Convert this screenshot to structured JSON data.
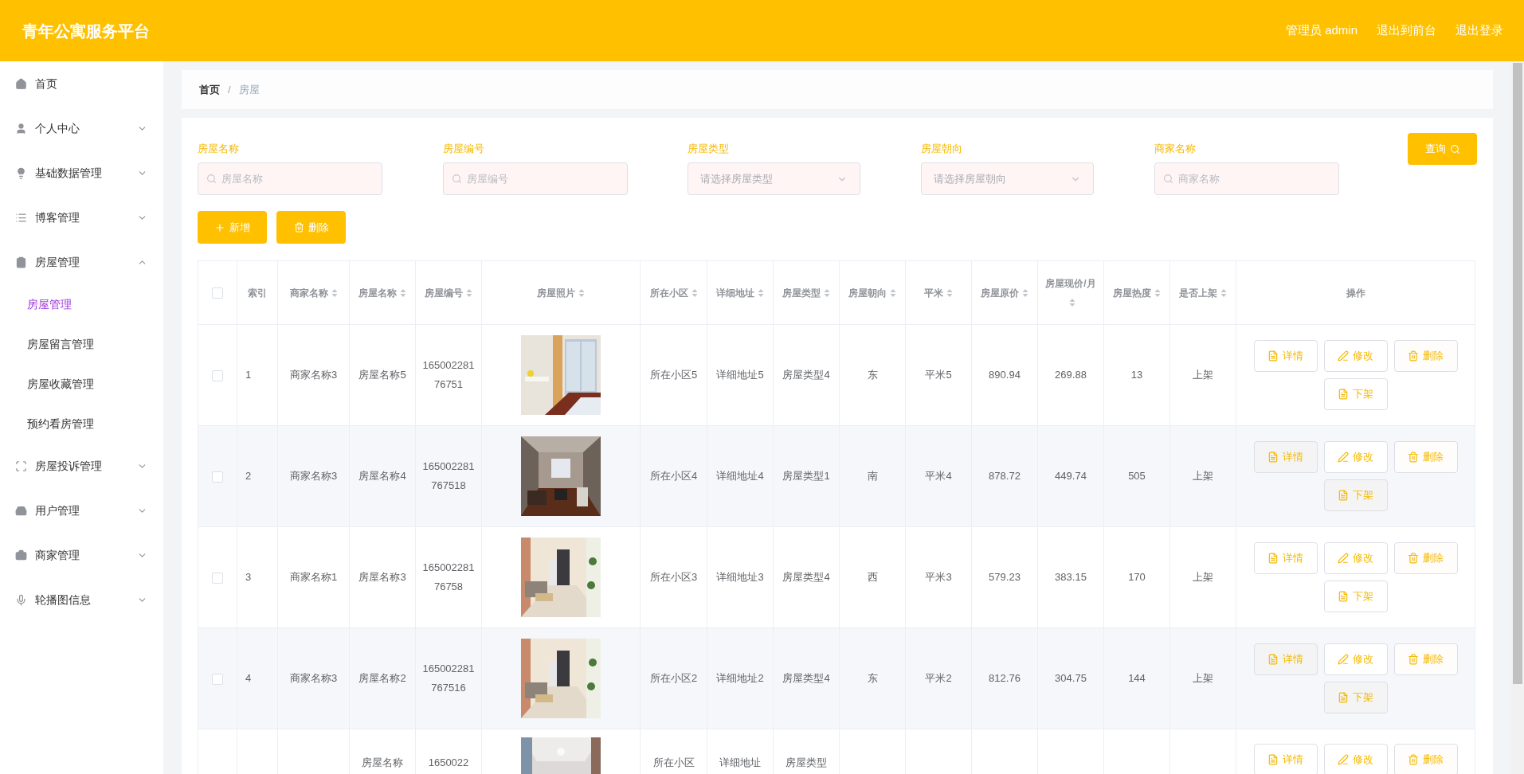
{
  "header": {
    "title": "青年公寓服务平台",
    "links": [
      "管理员 admin",
      "退出到前台",
      "退出登录"
    ]
  },
  "sidebar": {
    "items": [
      {
        "label": "首页",
        "selected": false
      },
      {
        "label": "个人中心",
        "selected": false,
        "expanded": false
      },
      {
        "label": "基础数据管理",
        "selected": false,
        "expanded": false
      },
      {
        "label": "博客管理",
        "selected": false,
        "expanded": false
      },
      {
        "label": "房屋管理",
        "selected": false,
        "expanded": true,
        "children": [
          {
            "label": "房屋管理",
            "selected": true
          },
          {
            "label": "房屋留言管理",
            "selected": false
          },
          {
            "label": "房屋收藏管理",
            "selected": false
          },
          {
            "label": "预约看房管理",
            "selected": false
          }
        ]
      },
      {
        "label": "房屋投诉管理",
        "selected": false,
        "expanded": false
      },
      {
        "label": "用户管理",
        "selected": false,
        "expanded": false
      },
      {
        "label": "商家管理",
        "selected": false,
        "expanded": false
      },
      {
        "label": "轮播图信息",
        "selected": false,
        "expanded": false
      }
    ]
  },
  "breadcrumb": [
    "首页",
    "/",
    "房屋"
  ],
  "filters": [
    {
      "kind": "input",
      "label": "房屋名称",
      "placeholder": "房屋名称"
    },
    {
      "kind": "input",
      "label": "房屋编号",
      "placeholder": "房屋编号"
    },
    {
      "kind": "select",
      "label": "房屋类型",
      "placeholder": "请选择房屋类型"
    },
    {
      "kind": "select",
      "label": "房屋朝向",
      "placeholder": "请选择房屋朝向"
    },
    {
      "kind": "input",
      "label": "商家名称",
      "placeholder": "商家名称"
    }
  ],
  "search_button": "查询",
  "actions": [
    {
      "kind": "add",
      "label": "新增"
    },
    {
      "kind": "delete",
      "label": "删除"
    }
  ],
  "table": {
    "header_checked": false,
    "columns": [
      {
        "label": "索引",
        "sortable": false
      },
      {
        "label": "商家名称",
        "sortable": true
      },
      {
        "label": "房屋名称",
        "sortable": true
      },
      {
        "label": "房屋编号",
        "sortable": true
      },
      {
        "label": "房屋照片",
        "sortable": true
      },
      {
        "label": "所在小区",
        "sortable": true
      },
      {
        "label": "详细地址",
        "sortable": true
      },
      {
        "label": "房屋类型",
        "sortable": true
      },
      {
        "label": "房屋朝向",
        "sortable": true
      },
      {
        "label": "平米",
        "sortable": true
      },
      {
        "label": "房屋原价",
        "sortable": true
      },
      {
        "label": "房屋现价/月",
        "sortable": true
      },
      {
        "label": "房屋热度",
        "sortable": true
      },
      {
        "label": "是否上架",
        "sortable": true
      },
      {
        "label": "操作",
        "sortable": false
      }
    ],
    "rows": [
      {
        "checked": false,
        "cells": [
          "1",
          "商家名称3",
          "房屋名称5",
          "16500228176751",
          null,
          "所在小区5",
          "详细地址5",
          "房屋类型4",
          "东",
          "平米5",
          "890.94",
          "269.88",
          "13",
          "上架"
        ],
        "buttons": [
          {
            "kind": "detail",
            "label": "详情"
          },
          {
            "kind": "edit",
            "label": "修改"
          },
          {
            "kind": "delete",
            "label": "删除"
          },
          {
            "kind": "detail",
            "label": "下架"
          }
        ]
      },
      {
        "checked": false,
        "cells": [
          "2",
          "商家名称3",
          "房屋名称4",
          "165002281767518",
          null,
          "所在小区4",
          "详细地址4",
          "房屋类型1",
          "南",
          "平米4",
          "878.72",
          "449.74",
          "505",
          "上架"
        ],
        "buttons": [
          {
            "kind": "detail",
            "label": "详情"
          },
          {
            "kind": "edit",
            "label": "修改"
          },
          {
            "kind": "delete",
            "label": "删除"
          },
          {
            "kind": "detail",
            "label": "下架"
          }
        ]
      },
      {
        "checked": false,
        "cells": [
          "3",
          "商家名称1",
          "房屋名称3",
          "16500228176758",
          null,
          "所在小区3",
          "详细地址3",
          "房屋类型4",
          "西",
          "平米3",
          "579.23",
          "383.15",
          "170",
          "上架"
        ],
        "buttons": [
          {
            "kind": "detail",
            "label": "详情"
          },
          {
            "kind": "edit",
            "label": "修改"
          },
          {
            "kind": "delete",
            "label": "删除"
          },
          {
            "kind": "detail",
            "label": "下架"
          }
        ]
      },
      {
        "checked": false,
        "cells": [
          "4",
          "商家名称3",
          "房屋名称2",
          "165002281767516",
          null,
          "所在小区2",
          "详细地址2",
          "房屋类型4",
          "东",
          "平米2",
          "812.76",
          "304.75",
          "144",
          "上架"
        ],
        "buttons": [
          {
            "kind": "detail",
            "label": "详情"
          },
          {
            "kind": "edit",
            "label": "修改"
          },
          {
            "kind": "delete",
            "label": "删除"
          },
          {
            "kind": "detail",
            "label": "下架"
          }
        ]
      },
      {
        "partial": true,
        "cells": [
          null,
          null,
          "房屋名称",
          "1650022",
          null,
          "所在小区",
          "详细地址",
          "房屋类型",
          null,
          null,
          null,
          null,
          null,
          null
        ],
        "buttons": [
          {
            "kind": "detail",
            "label": "详情"
          },
          {
            "kind": "edit",
            "label": "修改"
          },
          {
            "kind": "delete",
            "label": "删除"
          }
        ]
      }
    ]
  }
}
